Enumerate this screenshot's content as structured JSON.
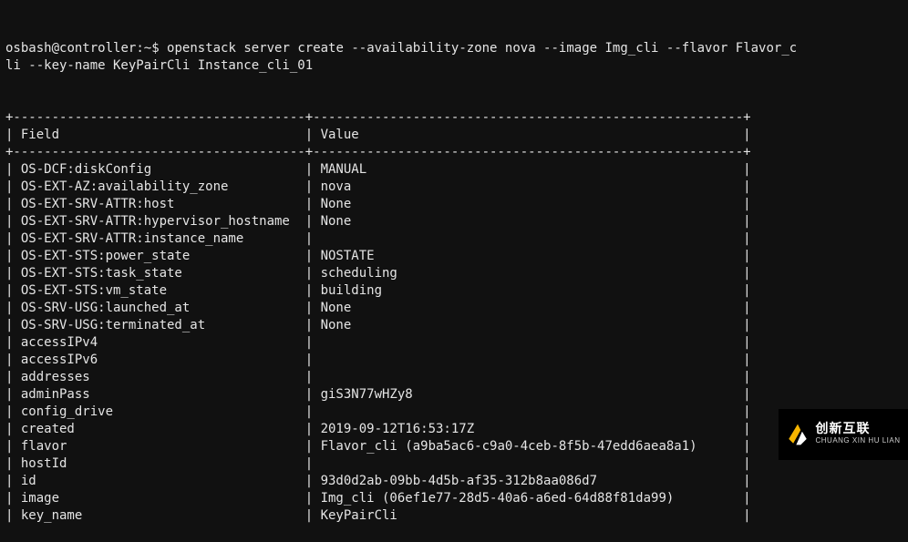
{
  "prompt": {
    "user": "osbash",
    "host": "controller",
    "path": "~",
    "command": "openstack server create --availability-zone nova --image Img_cli --flavor Flavor_cli --key-name KeyPairCli Instance_cli_01"
  },
  "table": {
    "width_field": 38,
    "width_value": 56,
    "header_field": "Field",
    "header_value": "Value",
    "rows": [
      {
        "field": "OS-DCF:diskConfig",
        "value": "MANUAL"
      },
      {
        "field": "OS-EXT-AZ:availability_zone",
        "value": "nova"
      },
      {
        "field": "OS-EXT-SRV-ATTR:host",
        "value": "None"
      },
      {
        "field": "OS-EXT-SRV-ATTR:hypervisor_hostname",
        "value": "None"
      },
      {
        "field": "OS-EXT-SRV-ATTR:instance_name",
        "value": ""
      },
      {
        "field": "OS-EXT-STS:power_state",
        "value": "NOSTATE"
      },
      {
        "field": "OS-EXT-STS:task_state",
        "value": "scheduling"
      },
      {
        "field": "OS-EXT-STS:vm_state",
        "value": "building"
      },
      {
        "field": "OS-SRV-USG:launched_at",
        "value": "None"
      },
      {
        "field": "OS-SRV-USG:terminated_at",
        "value": "None"
      },
      {
        "field": "accessIPv4",
        "value": ""
      },
      {
        "field": "accessIPv6",
        "value": ""
      },
      {
        "field": "addresses",
        "value": ""
      },
      {
        "field": "adminPass",
        "value": "giS3N77wHZy8"
      },
      {
        "field": "config_drive",
        "value": ""
      },
      {
        "field": "created",
        "value": "2019-09-12T16:53:17Z"
      },
      {
        "field": "flavor",
        "value": "Flavor_cli (a9ba5ac6-c9a0-4ceb-8f5b-47edd6aea8a1)"
      },
      {
        "field": "hostId",
        "value": ""
      },
      {
        "field": "id",
        "value": "93d0d2ab-09bb-4d5b-af35-312b8aa086d7"
      },
      {
        "field": "image",
        "value": "Img_cli (06ef1e77-28d5-40a6-a6ed-64d88f81da99)"
      },
      {
        "field": "key_name",
        "value": "KeyPairCli"
      }
    ]
  },
  "watermark": {
    "cn": "创新互联",
    "en": "CHUANG XIN HU LIAN"
  }
}
